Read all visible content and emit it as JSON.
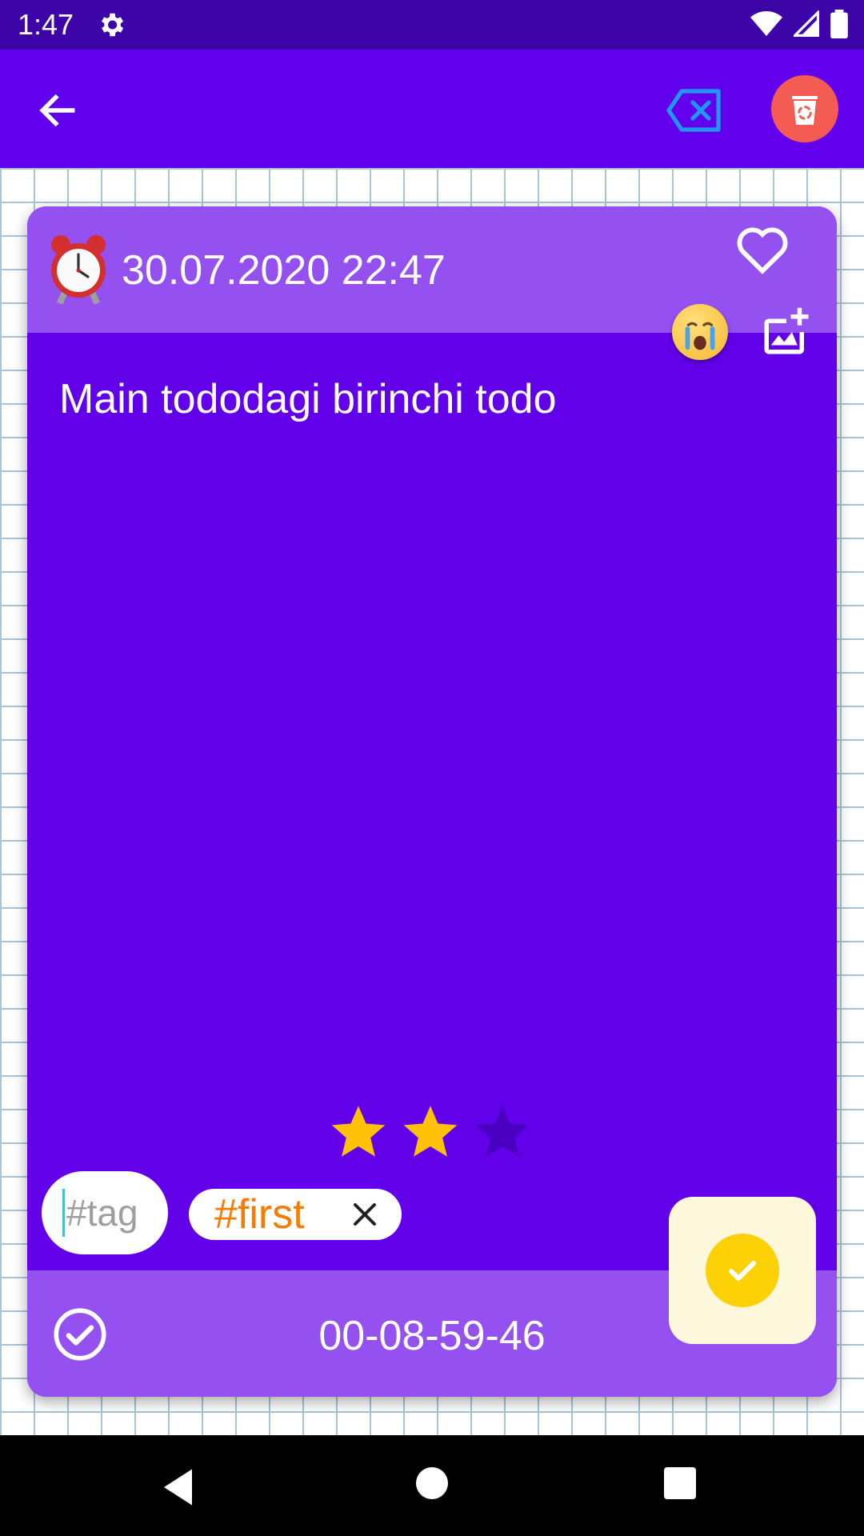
{
  "status_bar": {
    "time": "1:47",
    "icons": [
      "settings-icon",
      "wifi-icon",
      "signal-icon",
      "battery-icon"
    ]
  },
  "app_bar": {
    "icons": [
      "back-arrow-icon",
      "clear-tag-icon",
      "recycle-trash-icon"
    ],
    "colors": {
      "background": "#6200ee",
      "clear_icon": "#2196f3",
      "trash_bg": "#f45b53"
    }
  },
  "card": {
    "date": "30.07.2020 22:47",
    "text": "Main tododagi birinchi todo",
    "rating": {
      "filled": 2,
      "max": 3
    },
    "tag_input_placeholder": "#tag",
    "tags": [
      "#first"
    ],
    "timer": "00-08-59-46",
    "colors": {
      "body": "#6200ea",
      "header": "#9451f0",
      "star_filled": "#ffc107",
      "star_empty": "#4a00c0",
      "tag": "#f57c00"
    }
  },
  "actions": {
    "done_color": "#fcd106"
  }
}
